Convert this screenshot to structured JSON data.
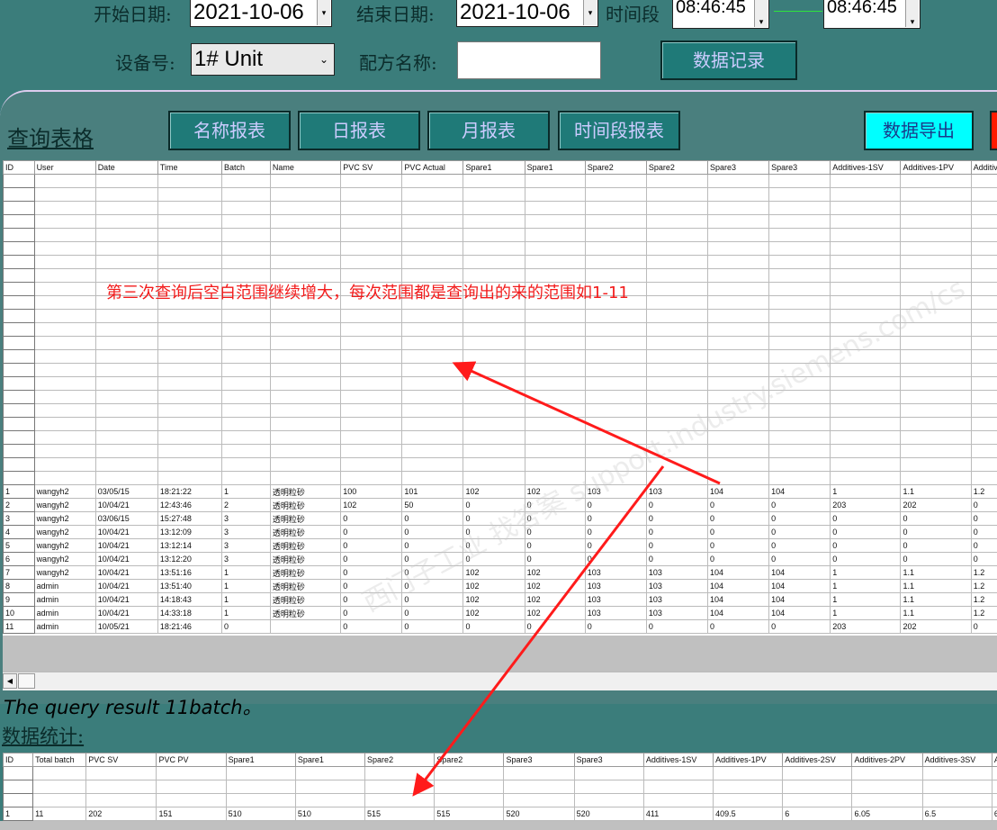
{
  "filters": {
    "start_date_label": "开始日期:",
    "start_date_value": "2021-10-06",
    "end_date_label": "结束日期:",
    "end_date_value": "2021-10-06",
    "time_range_label": "时间段",
    "time_from": "08:46:45",
    "time_to": "08:46:45",
    "device_label": "设备号:",
    "device_value": "1# Unit",
    "recipe_label": "配方名称:",
    "recipe_value": "",
    "record_button": "数据记录"
  },
  "panel": {
    "title": "查询表格",
    "buttons": [
      "名称报表",
      "日报表",
      "月报表",
      "时间段报表"
    ],
    "export_button": "数据导出"
  },
  "main_table": {
    "columns": [
      "ID",
      "User",
      "Date",
      "Time",
      "Batch",
      "Name",
      "PVC SV",
      "PVC Actual",
      "Spare1",
      "Spare1",
      "Spare2",
      "Spare2",
      "Spare3",
      "Spare3",
      "Additives-1SV",
      "Additives-1PV",
      "Additives-"
    ],
    "rows": [
      [
        "1",
        "wangyh2",
        "03/05/15",
        "18:21:22",
        "1",
        "透明粒砂",
        "100",
        "101",
        "102",
        "102",
        "103",
        "103",
        "104",
        "104",
        "1",
        "1.1",
        "1.2"
      ],
      [
        "2",
        "wangyh2",
        "10/04/21",
        "12:43:46",
        "2",
        "透明粒砂",
        "102",
        "50",
        "0",
        "0",
        "0",
        "0",
        "0",
        "0",
        "203",
        "202",
        "0"
      ],
      [
        "3",
        "wangyh2",
        "03/06/15",
        "15:27:48",
        "3",
        "透明粒砂",
        "0",
        "0",
        "0",
        "0",
        "0",
        "0",
        "0",
        "0",
        "0",
        "0",
        "0"
      ],
      [
        "4",
        "wangyh2",
        "10/04/21",
        "13:12:09",
        "3",
        "透明粒砂",
        "0",
        "0",
        "0",
        "0",
        "0",
        "0",
        "0",
        "0",
        "0",
        "0",
        "0"
      ],
      [
        "5",
        "wangyh2",
        "10/04/21",
        "13:12:14",
        "3",
        "透明粒砂",
        "0",
        "0",
        "0",
        "0",
        "0",
        "0",
        "0",
        "0",
        "0",
        "0",
        "0"
      ],
      [
        "6",
        "wangyh2",
        "10/04/21",
        "13:12:20",
        "3",
        "透明粒砂",
        "0",
        "0",
        "0",
        "0",
        "0",
        "0",
        "0",
        "0",
        "0",
        "0",
        "0"
      ],
      [
        "7",
        "wangyh2",
        "10/04/21",
        "13:51:16",
        "1",
        "透明粒砂",
        "0",
        "0",
        "102",
        "102",
        "103",
        "103",
        "104",
        "104",
        "1",
        "1.1",
        "1.2"
      ],
      [
        "8",
        "admin",
        "10/04/21",
        "13:51:40",
        "1",
        "透明粒砂",
        "0",
        "0",
        "102",
        "102",
        "103",
        "103",
        "104",
        "104",
        "1",
        "1.1",
        "1.2"
      ],
      [
        "9",
        "admin",
        "10/04/21",
        "14:18:43",
        "1",
        "透明粒砂",
        "0",
        "0",
        "102",
        "102",
        "103",
        "103",
        "104",
        "104",
        "1",
        "1.1",
        "1.2"
      ],
      [
        "10",
        "admin",
        "10/04/21",
        "14:33:18",
        "1",
        "透明粒砂",
        "0",
        "0",
        "102",
        "102",
        "103",
        "103",
        "104",
        "104",
        "1",
        "1.1",
        "1.2"
      ],
      [
        "11",
        "admin",
        "10/05/21",
        "18:21:46",
        "0",
        "",
        "0",
        "0",
        "0",
        "0",
        "0",
        "0",
        "0",
        "0",
        "203",
        "202",
        "0"
      ]
    ]
  },
  "annotation": "第三次查询后空白范围继续增大，每次范围都是查询出的来的范围如1-11",
  "result_text": "The query result 11batch。",
  "stats_label": "数据统计:",
  "stats_table": {
    "columns": [
      "ID",
      "Total batch",
      "PVC SV",
      "PVC PV",
      "Spare1",
      "Spare1",
      "Spare2",
      "Spare2",
      "Spare3",
      "Spare3",
      "Additives-1SV",
      "Additives-1PV",
      "Additives-2SV",
      "Additives-2PV",
      "Additives-3SV",
      "Ad"
    ],
    "rows": [
      [
        "1",
        "11",
        "202",
        "151",
        "510",
        "510",
        "515",
        "515",
        "520",
        "520",
        "411",
        "409.5",
        "6",
        "6.05",
        "6.5",
        "6."
      ]
    ]
  },
  "watermark": "西门子工业 找答案 support.industry.siemens.com/cs",
  "colors": {
    "background": "#3b7d7b",
    "button": "#1f7a78",
    "export_button": "#00ffff",
    "annotation": "#f21b1b"
  }
}
